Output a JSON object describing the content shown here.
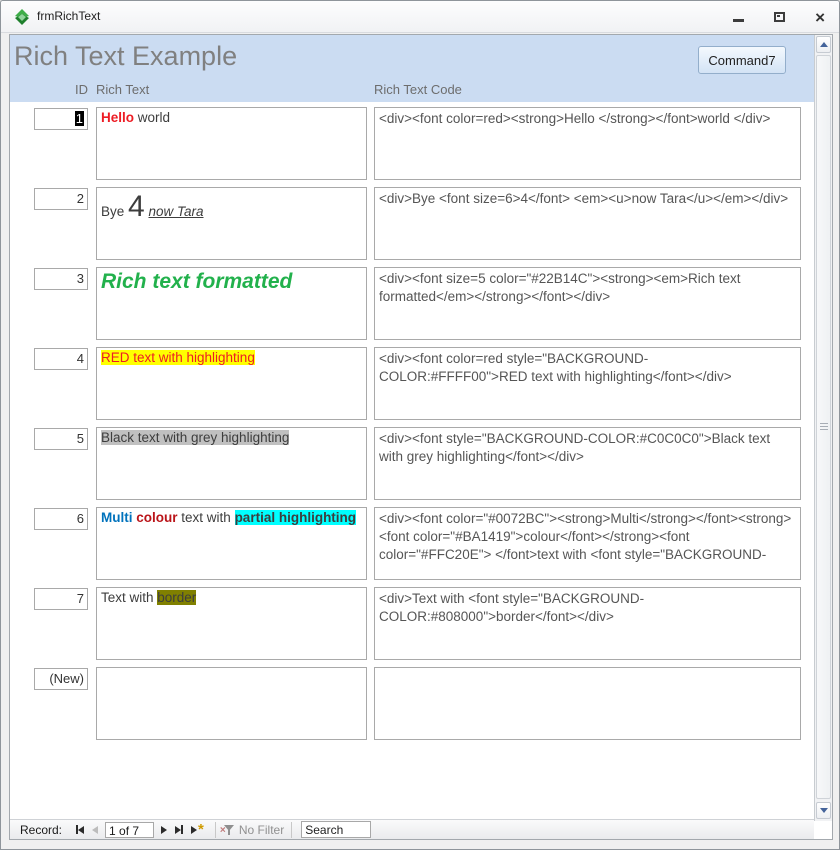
{
  "window": {
    "title": "frmRichText"
  },
  "header": {
    "title": "Rich Text Example",
    "button_label": "Command7"
  },
  "columns": {
    "id": "ID",
    "rich": "Rich Text",
    "code": "Rich Text Code"
  },
  "records": [
    {
      "id": "1",
      "id_selected": true,
      "rich": [
        {
          "t": "Hello ",
          "b": true,
          "c": "#ED1C24"
        },
        {
          "t": "world"
        }
      ],
      "code": "<div><font color=red><strong>Hello </strong></font>world </div>"
    },
    {
      "id": "2",
      "id_selected": false,
      "rich": [
        {
          "t": "Bye "
        },
        {
          "t": "4",
          "size": 30
        },
        {
          "t": " "
        },
        {
          "t": "now Tara",
          "i": true,
          "u": true
        }
      ],
      "code": "<div>Bye <font size=6>4</font> <em><u>now Tara</u></em></div>"
    },
    {
      "id": "3",
      "id_selected": false,
      "rich": [
        {
          "t": "Rich text formatted",
          "b": true,
          "i": true,
          "c": "#22B14C",
          "size": 21
        }
      ],
      "code": "<div><font size=5 color=\"#22B14C\"><strong><em>Rich text formatted</em></strong></font></div>"
    },
    {
      "id": "4",
      "id_selected": false,
      "rich": [
        {
          "t": "RED text with highlighting",
          "c": "#ED1C24",
          "bg": "#FFFF00"
        }
      ],
      "code": "<div><font color=red style=\"BACKGROUND-COLOR:#FFFF00\">RED text with highlighting</font></div>"
    },
    {
      "id": "5",
      "id_selected": false,
      "rich": [
        {
          "t": "Black text with grey highlighting",
          "bg": "#C0C0C0"
        }
      ],
      "code": "<div><font style=\"BACKGROUND-COLOR:#C0C0C0\">Black text with grey highlighting</font></div>"
    },
    {
      "id": "6",
      "id_selected": false,
      "rich": [
        {
          "t": "Multi",
          "b": true,
          "c": "#0072BC"
        },
        {
          "t": " "
        },
        {
          "t": "colour",
          "b": true,
          "c": "#BA1419"
        },
        {
          "t": " text with "
        },
        {
          "t": "partial highlighting",
          "b": true,
          "bg": "#00FFFF"
        }
      ],
      "code": "<div><font color=\"#0072BC\"><strong>Multi</strong></font><strong> <font color=\"#BA1419\">colour</font></strong><font color=\"#FFC20E\"> </font>text with <font style=\"BACKGROUND-"
    },
    {
      "id": "7",
      "id_selected": false,
      "rich": [
        {
          "t": "Text with "
        },
        {
          "t": "border",
          "bg": "#808000"
        }
      ],
      "code": "<div>Text with <font style=\"BACKGROUND-COLOR:#808000\">border</font></div>"
    },
    {
      "id": "(New)",
      "id_selected": false,
      "rich": [],
      "code": ""
    }
  ],
  "nav": {
    "record_label": "Record:",
    "position": "1 of 7",
    "filter_label": "No Filter",
    "search_value": "Search"
  },
  "colors": {
    "band_blue": "#cbdcf2",
    "title_gray": "#808080",
    "selection_black": "#000000",
    "rich_red": "#ED1C24",
    "rich_green": "#22B14C",
    "rich_blue": "#0072BC",
    "rich_dark_red": "#BA1419",
    "highlight_yellow": "#FFFF00",
    "highlight_grey": "#C0C0C0",
    "highlight_cyan": "#00FFFF",
    "highlight_olive": "#808000"
  }
}
